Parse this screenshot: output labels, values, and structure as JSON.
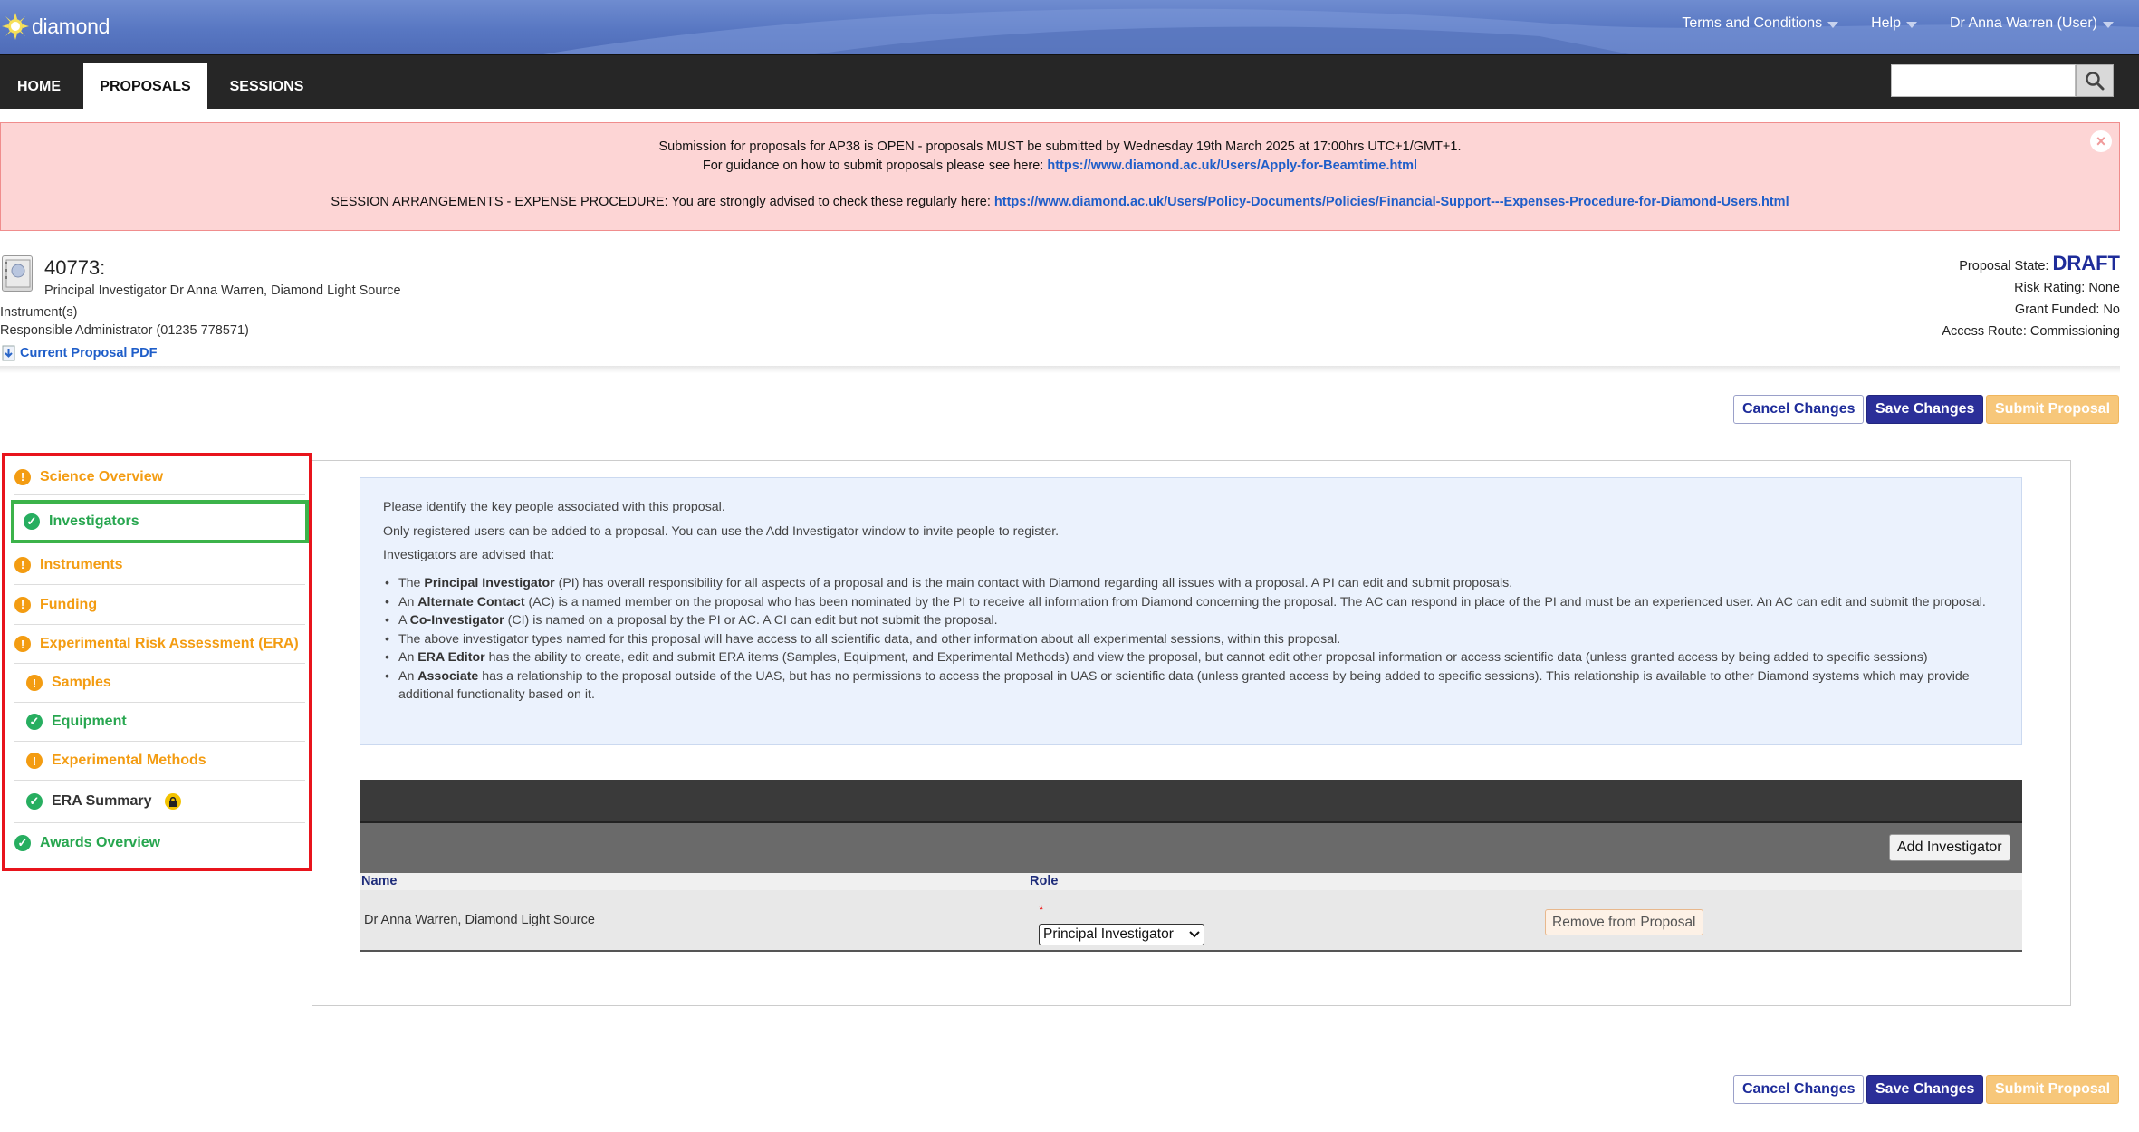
{
  "brand": {
    "logo_text": "diamond"
  },
  "topnav": {
    "terms": "Terms and Conditions",
    "help": "Help",
    "user": "Dr Anna Warren (User)"
  },
  "mainnav": {
    "tabs": [
      {
        "label": "HOME"
      },
      {
        "label": "PROPOSALS"
      },
      {
        "label": "SESSIONS"
      }
    ],
    "active_tab": "PROPOSALS",
    "search": {
      "value": "",
      "placeholder": ""
    }
  },
  "alert": {
    "line1": "Submission for proposals for AP38 is OPEN - proposals MUST be submitted by Wednesday 19th March 2025 at 17:00hrs UTC+1/GMT+1.",
    "line2_text": "For guidance on how to submit proposals please see here: ",
    "line2_link": "https://www.diamond.ac.uk/Users/Apply-for-Beamtime.html",
    "line3_text": "SESSION ARRANGEMENTS - EXPENSE PROCEDURE: You are strongly advised to check these regularly here: ",
    "line3_link": "https://www.diamond.ac.uk/Users/Policy-Documents/Policies/Financial-Support---Expenses-Procedure-for-Diamond-Users.html"
  },
  "proposal": {
    "number": "40773:",
    "pi": "Principal Investigator Dr Anna Warren, Diamond Light Source",
    "instruments": "Instrument(s)",
    "admin": "Responsible Administrator  (01235 778571)",
    "pdf_link": "Current Proposal PDF",
    "state_label": "Proposal State:",
    "state_value": "DRAFT",
    "risk_rating": "Risk Rating: None",
    "grant_funded": "Grant Funded: No",
    "access_route": "Access Route: Commissioning"
  },
  "actions": {
    "cancel": "Cancel Changes",
    "save": "Save Changes",
    "submit": "Submit Proposal"
  },
  "sidebar": {
    "items": [
      {
        "label": "Science Overview",
        "status": "warning"
      },
      {
        "label": "Investigators",
        "status": "complete",
        "selected": true
      },
      {
        "label": "Instruments",
        "status": "warning"
      },
      {
        "label": "Funding",
        "status": "warning"
      },
      {
        "label": "Experimental Risk Assessment (ERA)",
        "status": "warning"
      },
      {
        "label": "Samples",
        "status": "warning"
      },
      {
        "label": "Equipment",
        "status": "complete"
      },
      {
        "label": "Experimental Methods",
        "status": "warning"
      },
      {
        "label": "ERA Summary",
        "status": "complete",
        "locked": true
      },
      {
        "label": "Awards Overview",
        "status": "complete"
      }
    ]
  },
  "info": {
    "p1": "Please identify the key people associated with this proposal.",
    "p2": "Only registered users can be added to a proposal. You can use the Add Investigator window to invite people to register.",
    "p3": "Investigators are advised that:",
    "bullets": [
      {
        "pre": "The ",
        "bold": "Principal Investigator",
        "post": " (PI) has overall responsibility for all aspects of a proposal and is the main contact with Diamond regarding all issues with a proposal. A PI can edit and submit proposals."
      },
      {
        "pre": "An ",
        "bold": "Alternate Contact",
        "post": " (AC) is a named member on the proposal who has been nominated by the PI to receive all information from Diamond concerning the proposal. The AC can respond in place of the PI and must be an experienced user. An AC can edit and submit the proposal."
      },
      {
        "pre": "A ",
        "bold": "Co-Investigator",
        "post": " (CI) is named on a proposal by the PI or AC. A CI can edit but not submit the proposal."
      },
      {
        "pre": "",
        "bold": "",
        "post": "The above investigator types named for this proposal will have access to all scientific data, and other information about all experimental sessions, within this proposal."
      },
      {
        "pre": "An ",
        "bold": "ERA Editor",
        "post": " has the ability to create, edit and submit ERA items (Samples, Equipment, and Experimental Methods) and view the proposal, but cannot edit other proposal information or access scientific data (unless granted access by being added to specific sessions)"
      },
      {
        "pre": "An ",
        "bold": "Associate",
        "post": " has a relationship to the proposal outside of the UAS, but has no permissions to access the proposal in UAS or scientific data (unless granted access by being added to specific sessions). This relationship is available to other Diamond systems which may provide additional functionality based on it."
      }
    ]
  },
  "table": {
    "add_button": "Add Investigator",
    "columns": {
      "name": "Name",
      "role": "Role"
    },
    "rows": [
      {
        "name": "Dr Anna Warren, Diamond Light Source",
        "required_marker": "*",
        "role": "Principal Investigator",
        "remove": "Remove from Proposal"
      }
    ]
  },
  "colors": {
    "brand_blue": "#5877c2",
    "alert_bg": "#fdd5d5",
    "warning": "#f39c12",
    "complete": "#27ae60",
    "highlight_red": "#e8141c",
    "selected_green": "#3cb34a",
    "draft_blue": "#1e2c9a"
  }
}
